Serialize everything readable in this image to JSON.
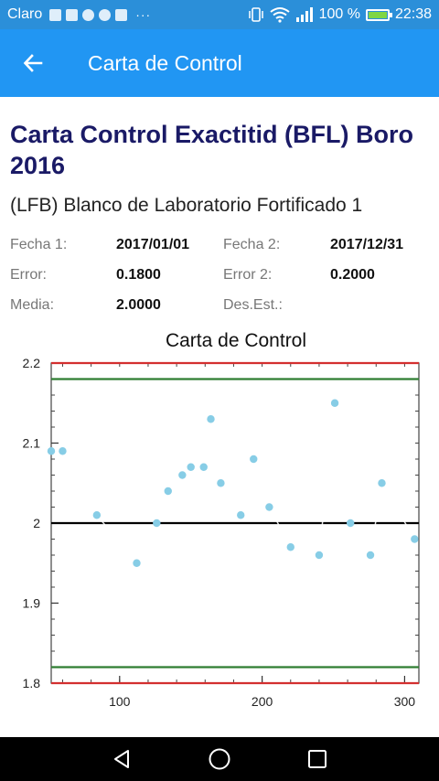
{
  "status_bar": {
    "carrier": "Claro",
    "overflow_indicator": "···",
    "battery_percent": "100 %",
    "time": "22:38",
    "icons": [
      "vibrate-icon",
      "wifi-icon",
      "signal-icon",
      "battery-charging-icon"
    ],
    "notification_icons": [
      "gallery-icon",
      "usb-icon",
      "google-icon",
      "messenger-icon",
      "contact-icon"
    ]
  },
  "app_bar": {
    "title": "Carta de Control",
    "back_icon": "arrow-left-icon",
    "color": "#2196f3"
  },
  "header": {
    "title": "Carta Control Exactitid (BFL) Boro 2016",
    "subtitle": "(LFB) Blanco de Laboratorio Fortificado 1"
  },
  "info": {
    "fecha1_label": "Fecha 1:",
    "fecha1_value": "2017/01/01",
    "fecha2_label": "Fecha 2:",
    "fecha2_value": "2017/12/31",
    "error_label": "Error:",
    "error_value": "0.1800",
    "error2_label": "Error 2:",
    "error2_value": "0.2000",
    "media_label": "Media:",
    "media_value": "2.0000",
    "desest_label": "Des.Est.:",
    "desest_value": ""
  },
  "chart_data": {
    "type": "line",
    "title": "Carta de Control",
    "xlabel": "",
    "ylabel": "",
    "xlim": [
      52,
      310
    ],
    "ylim": [
      1.8,
      2.2
    ],
    "x_ticks": [
      100,
      200,
      300
    ],
    "x_tick_labels": [
      "100",
      "200",
      "300"
    ],
    "y_ticks": [
      1.8,
      1.9,
      2.0,
      2.1,
      2.2
    ],
    "y_tick_labels": [
      "1.8",
      "1.9",
      "2",
      "2.1",
      "2.2"
    ],
    "grid": false,
    "reference_lines": [
      {
        "y": 2.2,
        "color": "#d32f2f"
      },
      {
        "y": 2.18,
        "color": "#2e7d32"
      },
      {
        "y": 2.0,
        "color": "#000000"
      },
      {
        "y": 1.82,
        "color": "#2e7d32"
      },
      {
        "y": 1.8,
        "color": "#d32f2f"
      }
    ],
    "series": [
      {
        "color": "#87cde6",
        "x": [
          52,
          60,
          84,
          112,
          126,
          134,
          144,
          150,
          159,
          164,
          171,
          185,
          194,
          205,
          220,
          240,
          251,
          262,
          276,
          284,
          307
        ],
        "y": [
          2.09,
          2.09,
          2.01,
          1.95,
          2.0,
          2.04,
          2.06,
          2.07,
          2.07,
          2.13,
          2.05,
          2.01,
          2.08,
          2.02,
          1.97,
          1.96,
          2.15,
          2.0,
          1.96,
          2.05,
          1.98
        ]
      }
    ]
  },
  "nav_bar": {
    "icons": [
      "back-triangle-icon",
      "home-circle-icon",
      "recents-square-icon"
    ]
  }
}
